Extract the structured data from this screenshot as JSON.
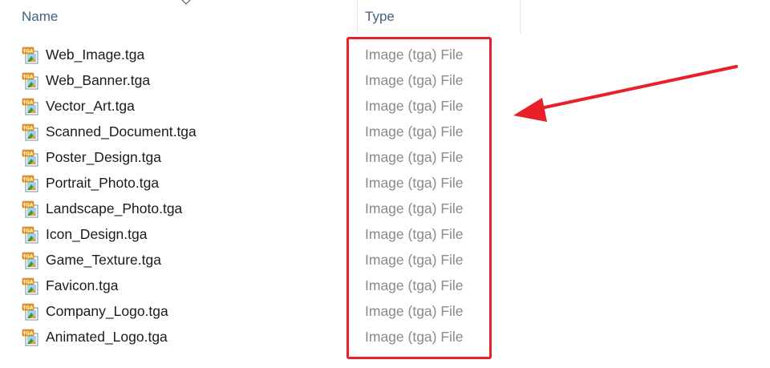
{
  "header": {
    "name_label": "Name",
    "type_label": "Type"
  },
  "files": [
    {
      "name": "Web_Image.tga",
      "type": "Image (tga) File"
    },
    {
      "name": "Web_Banner.tga",
      "type": "Image (tga) File"
    },
    {
      "name": "Vector_Art.tga",
      "type": "Image (tga) File"
    },
    {
      "name": "Scanned_Document.tga",
      "type": "Image (tga) File"
    },
    {
      "name": "Poster_Design.tga",
      "type": "Image (tga) File"
    },
    {
      "name": "Portrait_Photo.tga",
      "type": "Image (tga) File"
    },
    {
      "name": "Landscape_Photo.tga",
      "type": "Image (tga) File"
    },
    {
      "name": "Icon_Design.tga",
      "type": "Image (tga) File"
    },
    {
      "name": "Game_Texture.tga",
      "type": "Image (tga) File"
    },
    {
      "name": "Favicon.tga",
      "type": "Image (tga) File"
    },
    {
      "name": "Company_Logo.tga",
      "type": "Image (tga) File"
    },
    {
      "name": "Animated_Logo.tga",
      "type": "Image (tga) File"
    }
  ],
  "icons": {
    "file_icon": "tga-image-file-icon",
    "icon_label": "TGA",
    "sort": "chevron-down-icon"
  },
  "colors": {
    "annotation_red": "#e8202a",
    "header_text": "#44617f",
    "type_text": "#8a8a8a",
    "name_text": "#1b1b1b"
  }
}
